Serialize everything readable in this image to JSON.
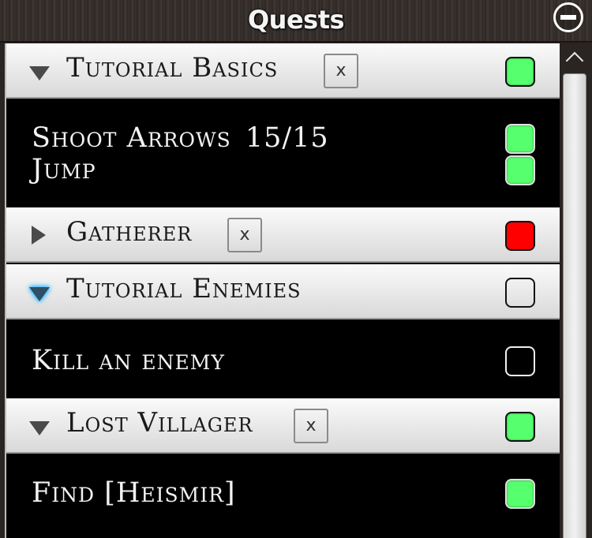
{
  "window": {
    "title": "Quests",
    "close_icon": "minus-circle-icon"
  },
  "quests": [
    {
      "title": "Tutorial Basics",
      "expanded": true,
      "removable": true,
      "remove_label": "x",
      "status": "complete",
      "objectives": [
        {
          "text": "Shoot Arrows",
          "count": "15/15",
          "status": "complete"
        },
        {
          "text": "Jump",
          "count": "",
          "status": "complete"
        }
      ]
    },
    {
      "title": "Gatherer",
      "expanded": false,
      "removable": true,
      "remove_label": "x",
      "status": "failed",
      "objectives": []
    },
    {
      "title": "Tutorial Enemies",
      "expanded": true,
      "highlighted": true,
      "removable": false,
      "status": "incomplete",
      "objectives": [
        {
          "text": "Kill an enemy",
          "count": "",
          "status": "incomplete"
        }
      ]
    },
    {
      "title": "Lost Villager",
      "expanded": true,
      "removable": true,
      "remove_label": "x",
      "status": "complete",
      "objectives": [
        {
          "text": "Find [Heismir]",
          "count": "",
          "status": "complete"
        }
      ]
    }
  ],
  "colors": {
    "complete": "#56ff6d",
    "failed": "#ff0000",
    "incomplete": "transparent",
    "highlight": "#33b8ff"
  }
}
